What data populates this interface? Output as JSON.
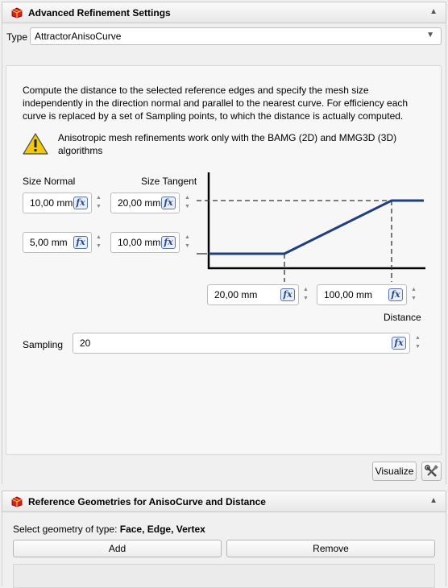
{
  "refinement_panel": {
    "title": "Advanced Refinement Settings",
    "type_label": "Type",
    "type_value": "AttractorAnisoCurve",
    "description": "Compute the distance to the selected reference edges and specify the mesh size independently in the direction normal and parallel to the nearest curve. For efficiency each curve is replaced by a set of Sampling points, to which the distance is actually computed.",
    "warning": "Anisotropic mesh refinements work only with the BAMG (2D) and MMG3D (3D) algorithms",
    "size_normal_label": "Size Normal",
    "size_tangent_label": "Size Tangent",
    "size_normal_max": "10,00 mm",
    "size_tangent_max": "20,00 mm",
    "size_normal_min": "5,00 mm",
    "size_tangent_min": "10,00 mm",
    "distance_min": "20,00 mm",
    "distance_max": "100,00 mm",
    "distance_label": "Distance",
    "sampling_label": "Sampling",
    "sampling_value": "20",
    "fx_label": "fx",
    "visualize_label": "Visualize"
  },
  "reference_panel": {
    "title": "Reference Geometries for AnisoCurve and Distance",
    "select_prefix": "Select geometry of type: ",
    "select_types": "Face, Edge, Vertex",
    "add_label": "Add",
    "remove_label": "Remove"
  },
  "icons": {
    "panel_icon": "mesh-cube-icon",
    "warning_icon": "warning-icon",
    "tools_icon": "wrench-screwdriver-icon"
  },
  "colors": {
    "curve": "#1f3f7f",
    "warning_fill": "#f2c811"
  }
}
